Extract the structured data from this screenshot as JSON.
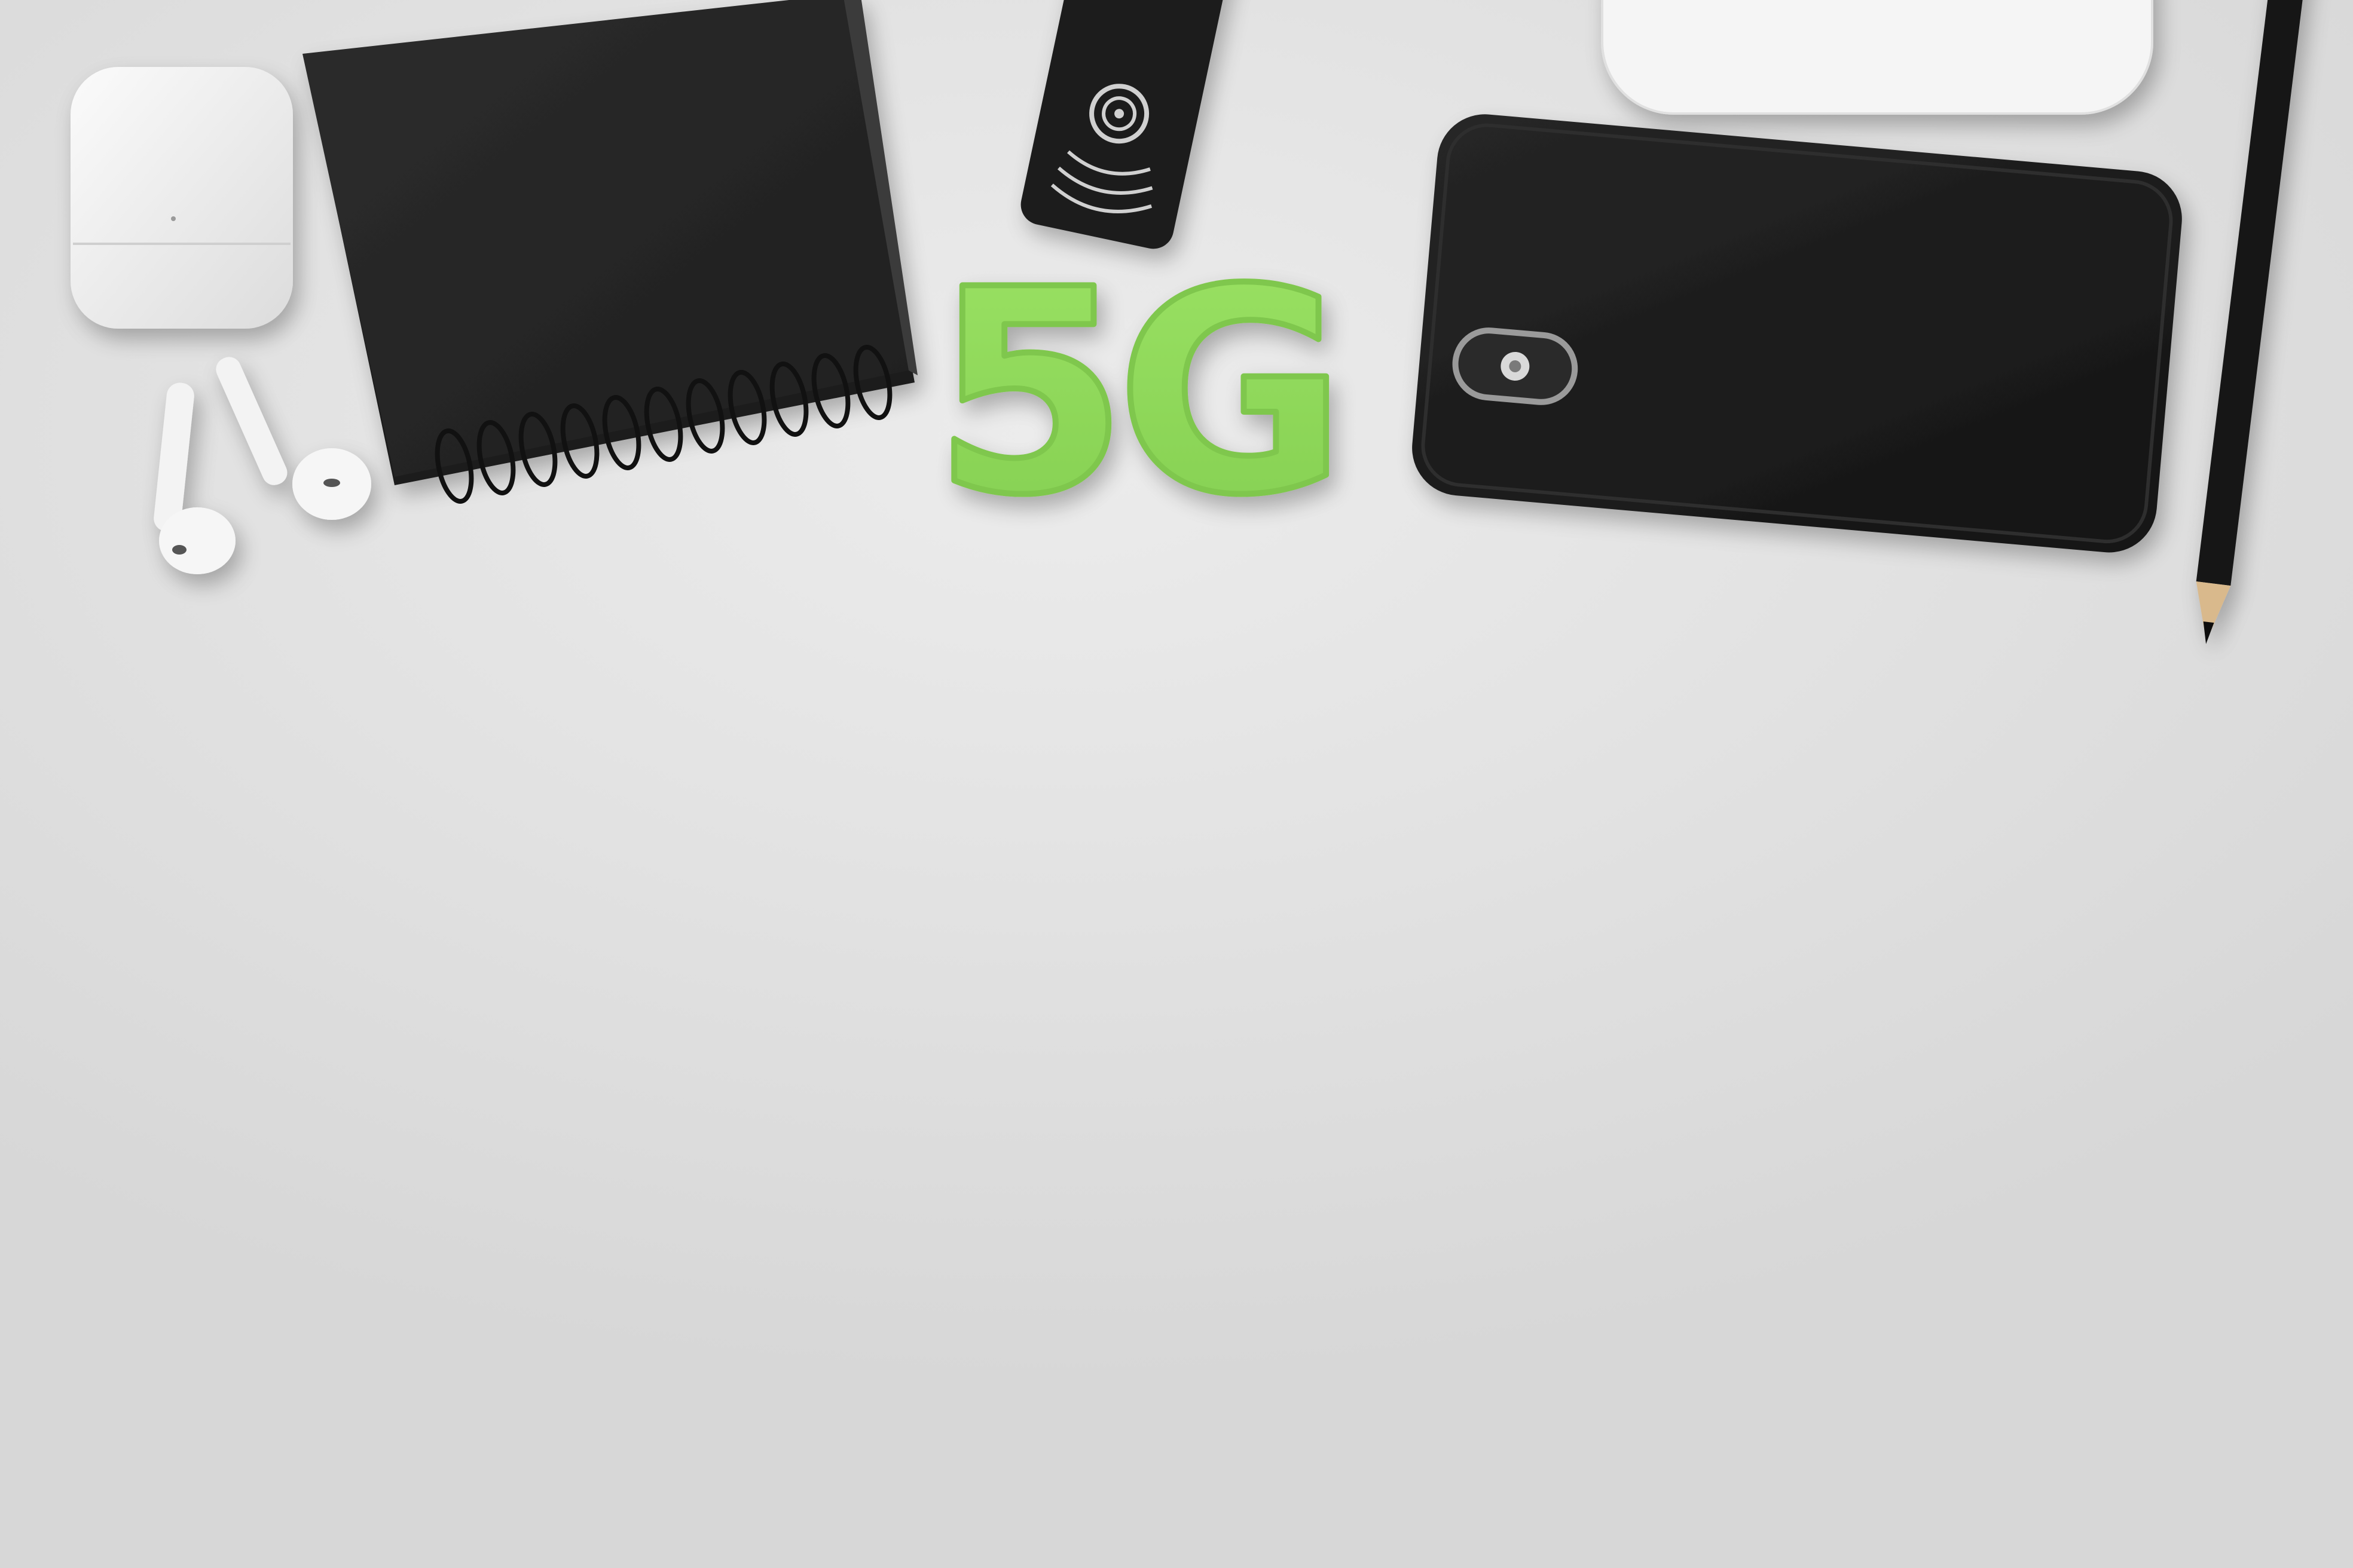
{
  "scene": {
    "background_color": "#e4e4e4",
    "objects": [
      "airpods-case",
      "left-earbud",
      "right-earbud",
      "spiral-notebook",
      "remote-control",
      "5g-foam-letters",
      "smartphone",
      "white-device",
      "pencil"
    ]
  },
  "foam_letters": {
    "text": "5G",
    "color": "#8fd95a"
  },
  "colors": {
    "notebook": "#262626",
    "phone": "#1c1c1c",
    "remote": "#1f1f1f",
    "white_device": "#f4f4f4",
    "pencil": "#141414",
    "pencil_wood": "#d9b98c"
  }
}
